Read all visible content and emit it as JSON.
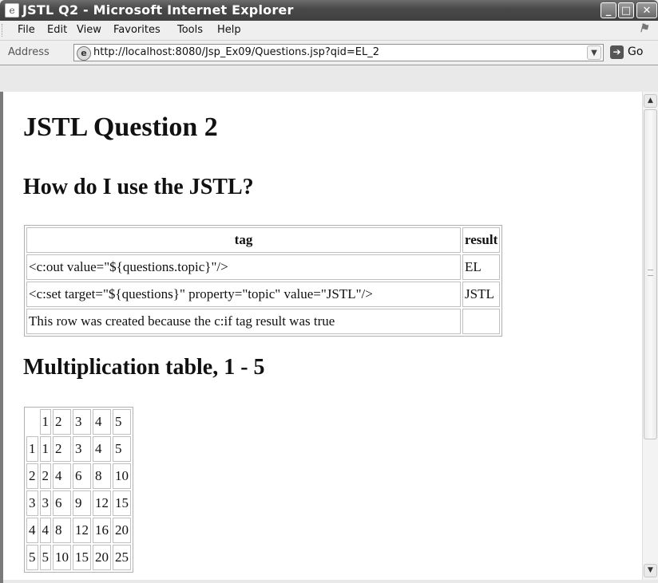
{
  "window": {
    "title": "JSTL Q2 - Microsoft Internet Explorer",
    "minimize": "_",
    "maximize": "□",
    "close": "✕"
  },
  "menu": {
    "items": [
      "File",
      "Edit",
      "View",
      "Favorites",
      "Tools",
      "Help"
    ]
  },
  "address": {
    "label": "Address",
    "url": "http://localhost:8080/Jsp_Ex09/Questions.jsp?qid=EL_2",
    "go_label": "Go"
  },
  "page": {
    "heading": "JSTL Question 2",
    "question": "How do I use the JSTL?",
    "jstl_table": {
      "headers": [
        "tag",
        "result"
      ],
      "rows": [
        [
          "<c:out value=\"${questions.topic}\"/>",
          "EL"
        ],
        [
          "<c:set target=\"${questions}\" property=\"topic\" value=\"JSTL\"/>",
          "JSTL"
        ],
        [
          "This row was created because the c:if tag result was true",
          ""
        ]
      ]
    },
    "mult_heading": "Multiplication table, 1 - 5",
    "mult_table": {
      "header": [
        "",
        "1",
        "2",
        "3",
        "4",
        "5"
      ],
      "rows": [
        [
          "1",
          "1",
          "2",
          "3",
          "4",
          "5"
        ],
        [
          "2",
          "2",
          "4",
          "6",
          "8",
          "10"
        ],
        [
          "3",
          "3",
          "6",
          "9",
          "12",
          "15"
        ],
        [
          "4",
          "4",
          "8",
          "12",
          "16",
          "20"
        ],
        [
          "5",
          "5",
          "10",
          "15",
          "20",
          "25"
        ]
      ]
    }
  },
  "icons": {
    "app": "ie-page-icon",
    "address_page": "ie-globe-icon",
    "go": "go-arrow-icon",
    "throbber": "windows-flag-icon"
  }
}
